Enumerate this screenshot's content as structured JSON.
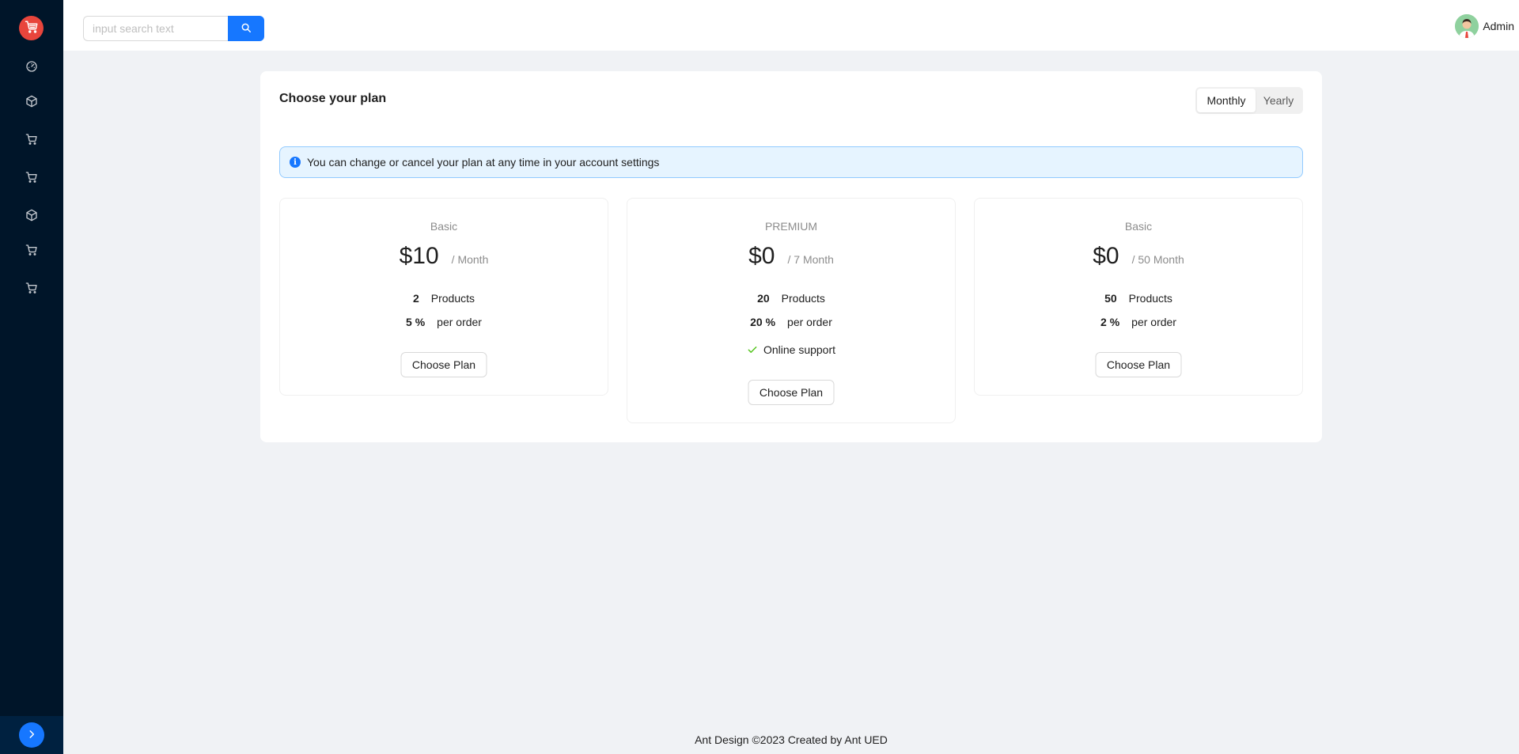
{
  "sidebar": {
    "logo_icon": "shopping-cart-icon",
    "items": [
      {
        "icon": "dashboard-icon"
      },
      {
        "icon": "box-icon"
      },
      {
        "icon": "cart-icon"
      },
      {
        "icon": "cart-icon"
      },
      {
        "icon": "box-icon"
      },
      {
        "icon": "cart-icon"
      },
      {
        "icon": "cart-icon"
      }
    ],
    "collapse_icon": "chevron-right-icon"
  },
  "header": {
    "search": {
      "placeholder": "input search text",
      "value": ""
    },
    "user": {
      "name": "Admin"
    }
  },
  "main": {
    "title": "Choose your plan",
    "billing_toggle": {
      "options": [
        "Monthly",
        "Yearly"
      ],
      "selected": "Monthly"
    },
    "alert": {
      "text": "You can change or cancel your plan at any time in your account settings"
    },
    "plans": [
      {
        "name": "Basic",
        "price": "$10",
        "period": "/ Month",
        "products_count": "2",
        "products_label": "Products",
        "commission": "5 %",
        "commission_label": "per order",
        "button": "Choose Plan"
      },
      {
        "name": "PREMIUM",
        "price": "$0",
        "period": "/ 7 Month",
        "products_count": "20",
        "products_label": "Products",
        "commission": "20 %",
        "commission_label": "per order",
        "support": "Online support",
        "button": "Choose Plan"
      },
      {
        "name": "Basic",
        "price": "$0",
        "period": "/ 50 Month",
        "products_count": "50",
        "products_label": "Products",
        "commission": "2 %",
        "commission_label": "per order",
        "button": "Choose Plan"
      }
    ]
  },
  "footer": {
    "text": "Ant Design ©2023 Created by Ant UED"
  },
  "colors": {
    "sidebar_bg": "#001529",
    "primary": "#1677ff",
    "logo": "#e8453c",
    "success": "#52c41a"
  }
}
